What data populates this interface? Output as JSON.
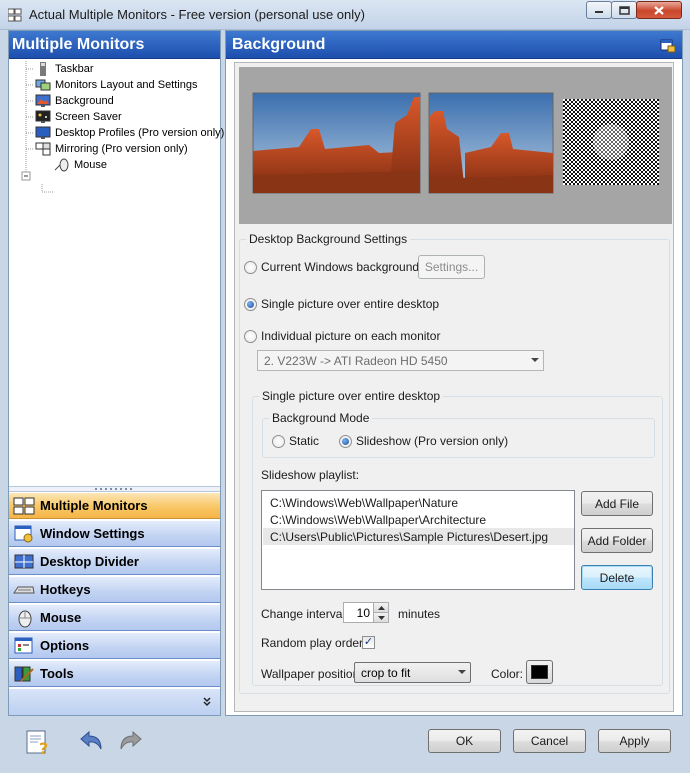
{
  "window": {
    "title": "Actual Multiple Monitors - Free version (personal use only)"
  },
  "left_panel": {
    "title": "Multiple Monitors",
    "tree": [
      {
        "label": "Taskbar",
        "icon": "taskbar-icon"
      },
      {
        "label": "Monitors Layout and Settings",
        "icon": "monitors-layout-icon"
      },
      {
        "label": "Background",
        "icon": "background-icon"
      },
      {
        "label": "Screen Saver",
        "icon": "screen-saver-icon"
      },
      {
        "label": "Desktop Profiles (Pro version only)",
        "icon": "desktop-profiles-icon"
      },
      {
        "label": "Mirroring (Pro version only)",
        "icon": "mirroring-icon"
      },
      {
        "label": "Mouse",
        "icon": "mouse-icon"
      }
    ],
    "nav": [
      {
        "label": "Multiple Monitors",
        "icon": "multiple-monitors-icon",
        "active": true
      },
      {
        "label": "Window Settings",
        "icon": "window-settings-icon"
      },
      {
        "label": "Desktop Divider",
        "icon": "desktop-divider-icon"
      },
      {
        "label": "Hotkeys",
        "icon": "hotkeys-icon"
      },
      {
        "label": "Mouse",
        "icon": "mouse-nav-icon"
      },
      {
        "label": "Options",
        "icon": "options-icon"
      },
      {
        "label": "Tools",
        "icon": "tools-icon"
      }
    ],
    "more_icon": "double-chevron-down-icon"
  },
  "right_panel": {
    "title": "Background",
    "settings_group": {
      "legend": "Desktop Background Settings",
      "current_windows": "Current Windows background",
      "settings_button": "Settings...",
      "single_picture": "Single picture over entire desktop",
      "individual_picture": "Individual picture on each monitor",
      "monitor_select": "2. V223W -> ATI Radeon HD 5450",
      "selected_mode": "single_picture"
    },
    "single_group": {
      "legend": "Single picture over entire desktop",
      "mode_legend": "Background Mode",
      "static_label": "Static",
      "slideshow_label": "Slideshow (Pro version only)",
      "selected_mode": "slideshow",
      "playlist_label": "Slideshow playlist:",
      "playlist": [
        "C:\\Windows\\Web\\Wallpaper\\Nature",
        "C:\\Windows\\Web\\Wallpaper\\Architecture",
        "C:\\Users\\Public\\Pictures\\Sample Pictures\\Desert.jpg"
      ],
      "add_file": "Add File",
      "add_folder": "Add Folder",
      "delete": "Delete",
      "interval_label": "Change interval:",
      "interval_value": "10",
      "interval_unit": "minutes",
      "random_label": "Random play order",
      "random_checked": true,
      "position_label": "Wallpaper position:",
      "position_value": "crop to fit",
      "color_label": "Color:",
      "color_value": "#000000"
    }
  },
  "footer": {
    "help_icon": "help-icon",
    "undo_icon": "undo-icon",
    "redo_icon": "redo-icon",
    "ok": "OK",
    "cancel": "Cancel",
    "apply": "Apply"
  }
}
